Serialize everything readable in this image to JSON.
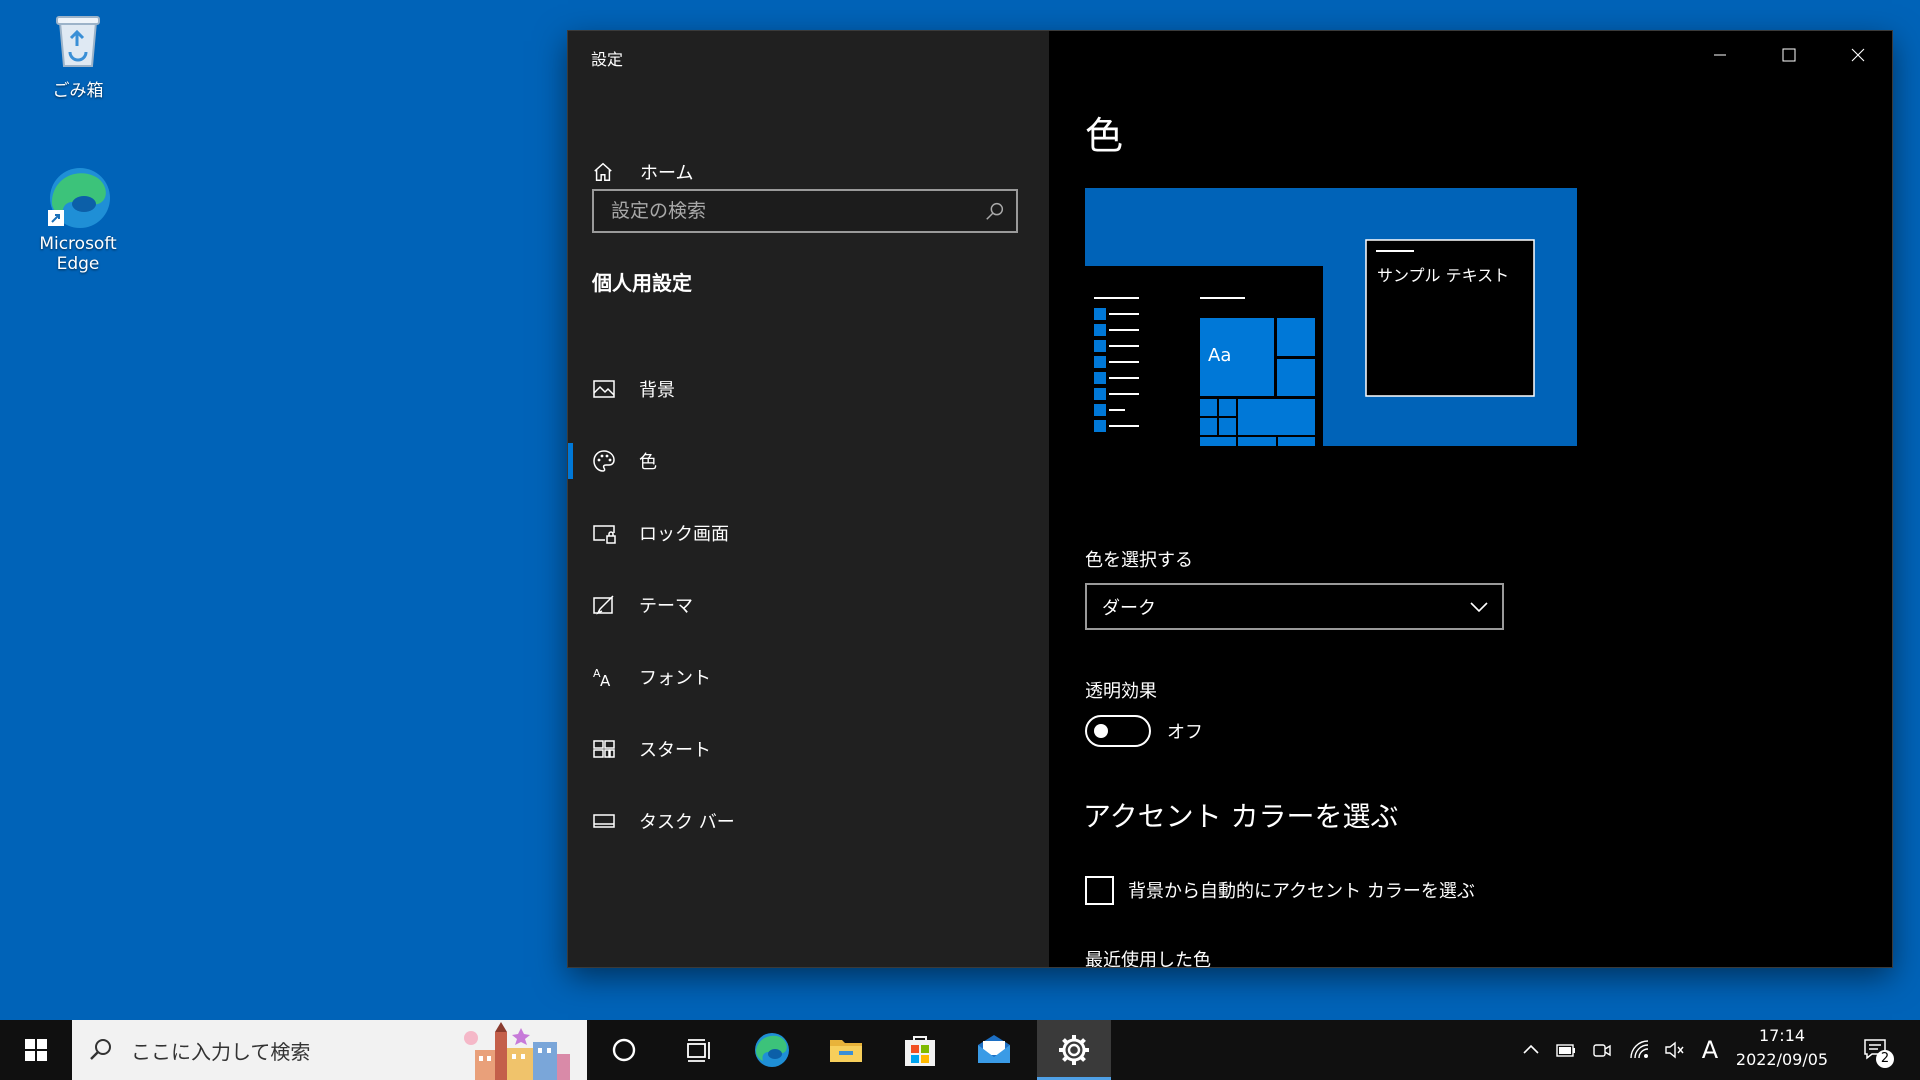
{
  "desktop": {
    "icons": [
      {
        "label": "ごみ箱"
      },
      {
        "label": "Microsoft Edge"
      }
    ]
  },
  "window": {
    "title": "設定"
  },
  "sidebar": {
    "home_label": "ホーム",
    "search_placeholder": "設定の検索",
    "section_title": "個人用設定",
    "items": [
      {
        "label": "背景"
      },
      {
        "label": "色"
      },
      {
        "label": "ロック画面"
      },
      {
        "label": "テーマ"
      },
      {
        "label": "フォント"
      },
      {
        "label": "スタート"
      },
      {
        "label": "タスク バー"
      }
    ],
    "active_index": 1
  },
  "main": {
    "title": "色",
    "preview": {
      "sample_text": "サンプル テキスト",
      "tile_text": "Aa"
    },
    "color_mode_label": "色を選択する",
    "color_mode_value": "ダーク",
    "transparency_label": "透明効果",
    "transparency_state": "オフ",
    "accent_title": "アクセント カラーを選ぶ",
    "auto_accent_label": "背景から自動的にアクセント カラーを選ぶ",
    "recent_colors_label": "最近使用した色"
  },
  "taskbar": {
    "search_placeholder": "ここに入力して検索",
    "clock_time": "17:14",
    "clock_date": "2022/09/05",
    "ime_label": "A",
    "notification_count": "2"
  },
  "colors": {
    "desktop": "#0063b8",
    "accent": "#0078d7",
    "sidebar": "#202020",
    "taskbar": "#101010"
  }
}
